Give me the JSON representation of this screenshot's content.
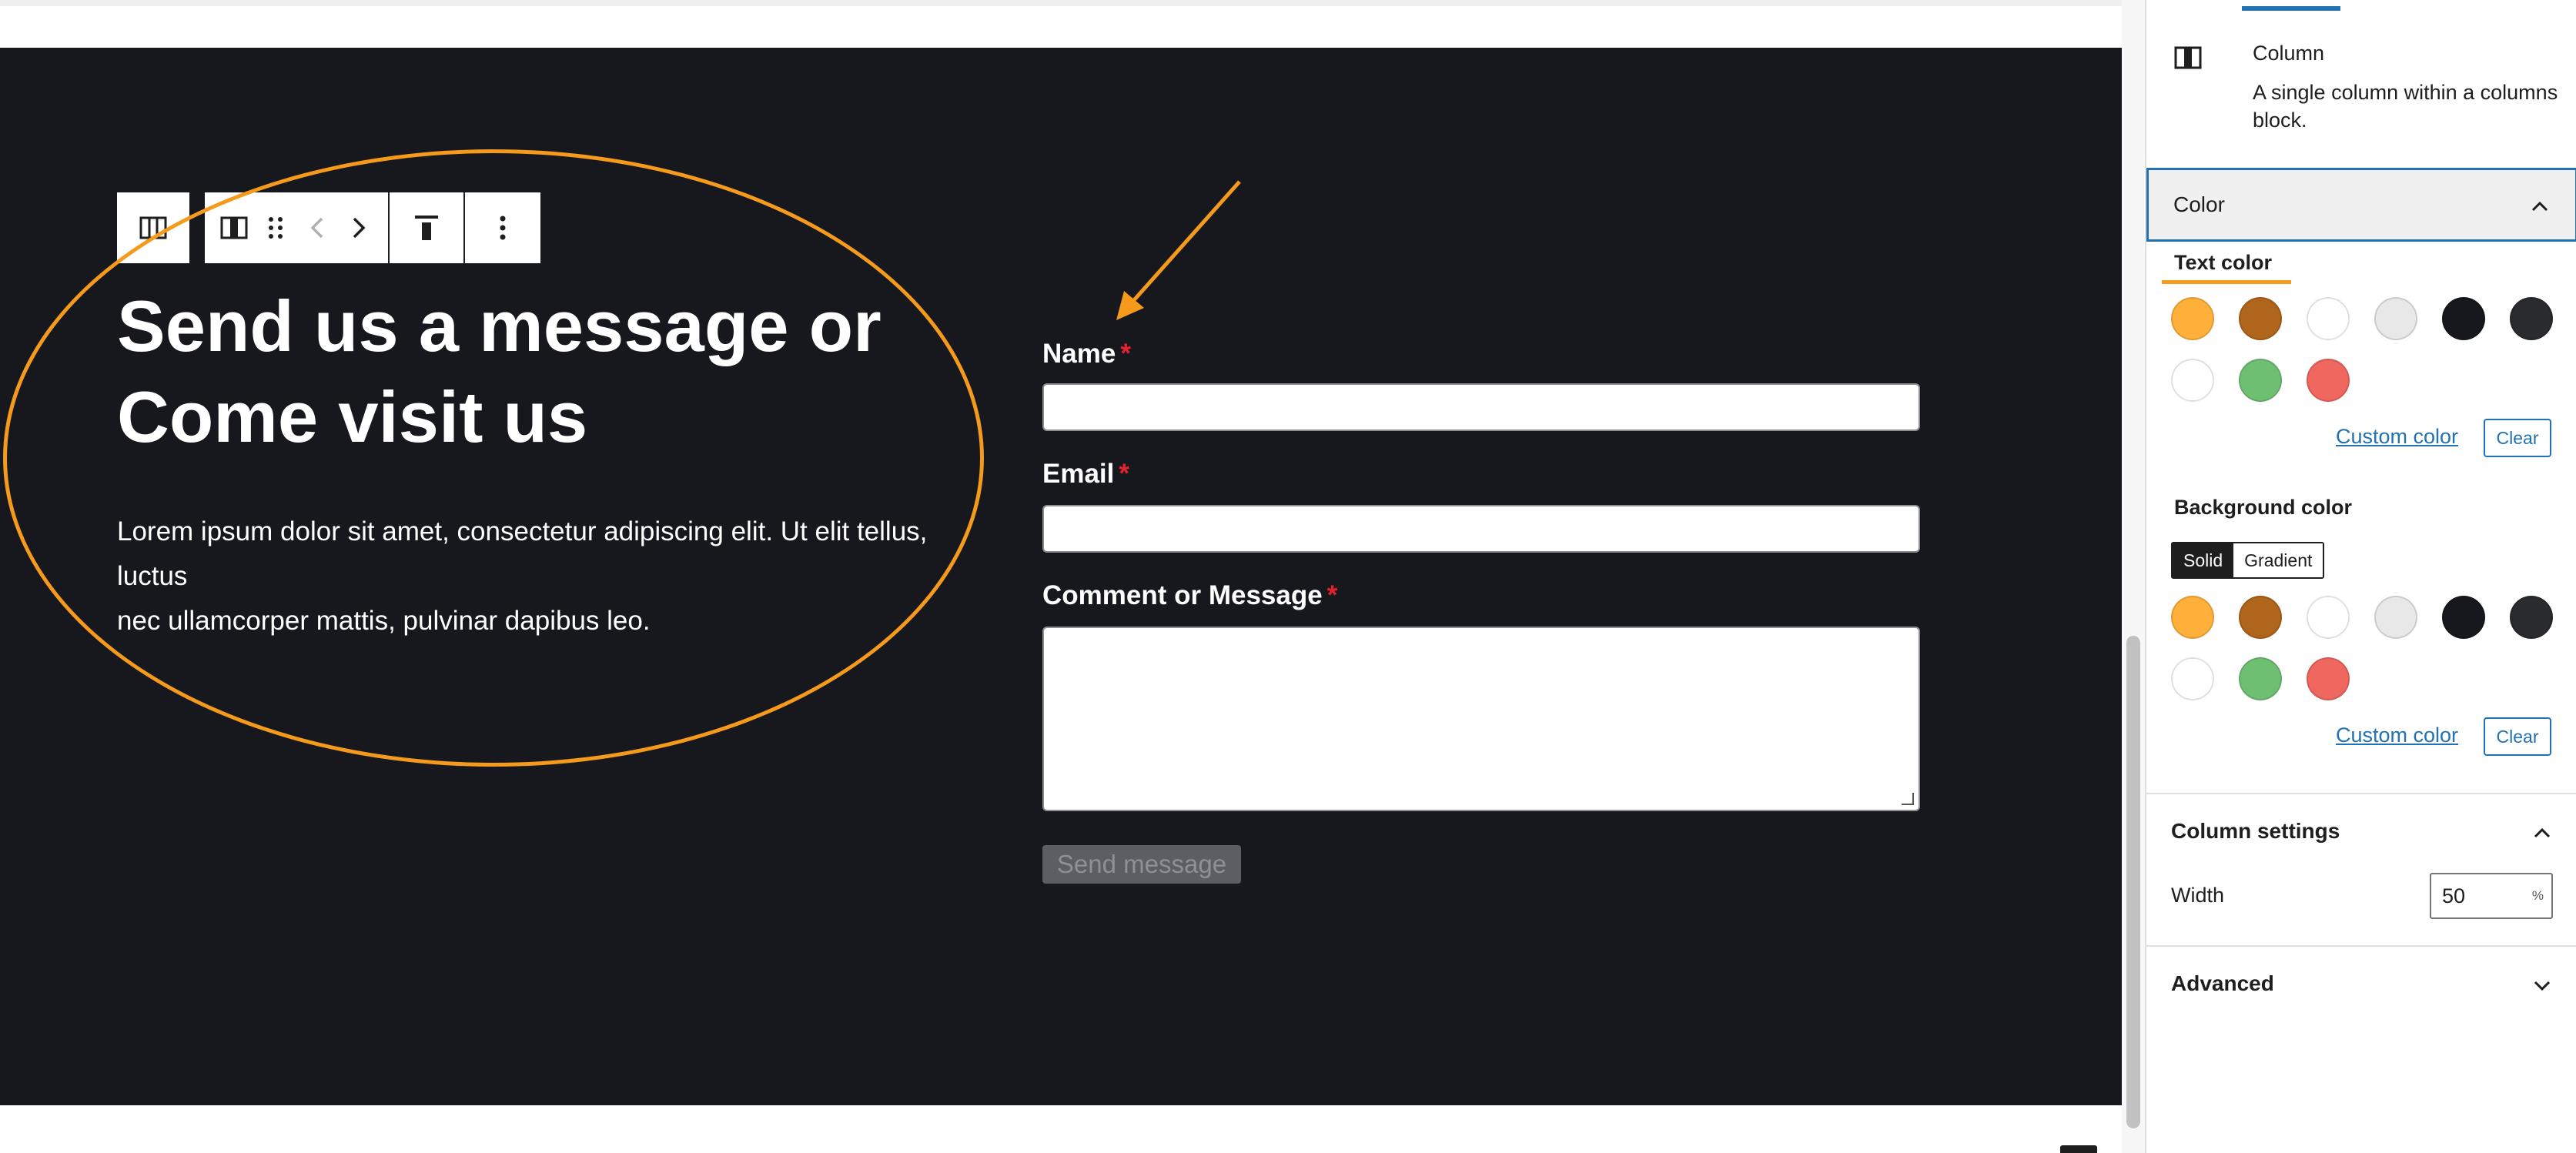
{
  "canvas": {
    "heading_line1": "Send us a message or",
    "heading_line2": "Come visit us",
    "paragraph_line1": "Lorem ipsum dolor sit amet, consectetur adipiscing elit. Ut elit tellus, luctus",
    "paragraph_line2": "nec ullamcorper mattis, pulvinar dapibus leo.",
    "toolbar_icons": [
      "columns-icon",
      "column-icon",
      "drag-handle-icon",
      "chevron-left-icon",
      "chevron-right-icon",
      "align-top-icon",
      "more-options-icon"
    ],
    "form": {
      "name_label": "Name",
      "email_label": "Email",
      "message_label": "Comment or Message",
      "required_mark": "*",
      "submit_label": "Send message"
    },
    "annotation_color": "#f59a1b",
    "section_background": "#16181d"
  },
  "sidebar": {
    "block": {
      "title": "Column",
      "description": "A single column within a columns block."
    },
    "color_panel": {
      "title": "Color",
      "text_color_label": "Text color",
      "background_color_label": "Background color",
      "custom_color_label": "Custom color",
      "clear_label": "Clear",
      "solid_label": "Solid",
      "gradient_label": "Gradient",
      "palette": [
        "#ffb03b",
        "#b0651c",
        "#ffffff",
        "#e8e8e8",
        "#16181d",
        "#2a2b2e",
        "#ffffff",
        "#6fbf73",
        "#f0675f"
      ]
    },
    "column_settings": {
      "title": "Column settings",
      "width_label": "Width",
      "width_value": "50",
      "width_unit": "%"
    },
    "advanced": {
      "title": "Advanced"
    },
    "accent_color": "#2271b1"
  }
}
